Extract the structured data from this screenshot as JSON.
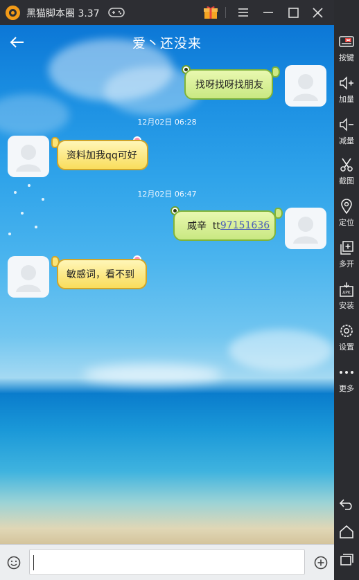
{
  "emulator": {
    "app_title": "黑猫脚本圈 3.37",
    "icons": [
      "logo-icon",
      "gamepad-icon",
      "gift-icon",
      "menu-icon",
      "minimize-icon",
      "maximize-icon",
      "close-icon",
      "collapse-icon"
    ]
  },
  "chat": {
    "title": "爱丶还没来",
    "messages": [
      {
        "side": "right",
        "style": "green",
        "text": "找呀找呀找朋友"
      },
      {
        "side": "left",
        "style": "yellow",
        "timestamp": "12月02日 06:28",
        "text": "资料加我qq可好"
      },
      {
        "side": "right",
        "style": "green",
        "timestamp": "12月02日 06:47",
        "text_prefix": "威辛  tt",
        "link": "97151636"
      },
      {
        "side": "left",
        "style": "yellow",
        "text": "敏感词，看不到"
      }
    ]
  },
  "input": {
    "value": "",
    "icons": [
      "emoji-icon",
      "plus-icon"
    ]
  },
  "sidebar": {
    "items": [
      {
        "label": "按键",
        "icon": "keyboard-icon"
      },
      {
        "label": "加量",
        "icon": "volume-up-icon"
      },
      {
        "label": "减量",
        "icon": "volume-down-icon"
      },
      {
        "label": "截图",
        "icon": "scissors-icon"
      },
      {
        "label": "定位",
        "icon": "location-icon"
      },
      {
        "label": "多开",
        "icon": "multi-instance-icon"
      },
      {
        "label": "安装",
        "icon": "apk-install-icon"
      },
      {
        "label": "设置",
        "icon": "gear-icon"
      },
      {
        "label": "更多",
        "icon": "more-icon"
      }
    ],
    "nav_icons": [
      "back-nav-icon",
      "home-nav-icon",
      "recents-nav-icon"
    ]
  },
  "colors": {
    "bubble_green": "#c9e882",
    "bubble_yellow": "#f9dd5c",
    "link": "#4d62b8",
    "chrome_dark": "#2d2e33"
  }
}
